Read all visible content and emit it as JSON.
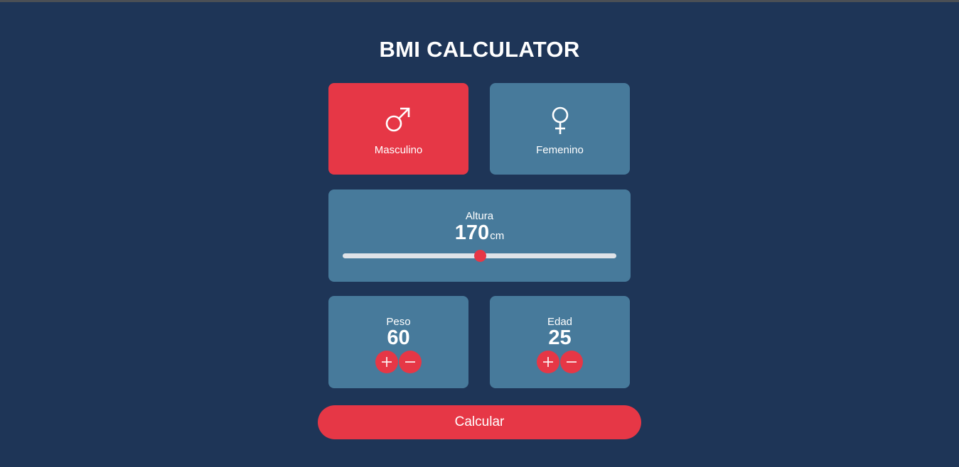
{
  "app": {
    "title": "BMI CALCULATOR"
  },
  "gender": {
    "male": {
      "label": "Masculino",
      "icon": "male-symbol-icon",
      "selected": true
    },
    "female": {
      "label": "Femenino",
      "icon": "female-symbol-icon",
      "selected": false
    }
  },
  "height": {
    "label": "Altura",
    "value": "170",
    "unit": "cm",
    "slider_fraction": 0.5
  },
  "weight": {
    "label": "Peso",
    "value": "60",
    "plus_icon": "plus-icon",
    "minus_icon": "minus-icon"
  },
  "age": {
    "label": "Edad",
    "value": "25",
    "plus_icon": "plus-icon",
    "minus_icon": "minus-icon"
  },
  "actions": {
    "calculate_label": "Calcular"
  },
  "colors": {
    "background": "#1e3557",
    "card": "#477a9b",
    "accent": "#e63746",
    "track": "#dfe3e8"
  }
}
